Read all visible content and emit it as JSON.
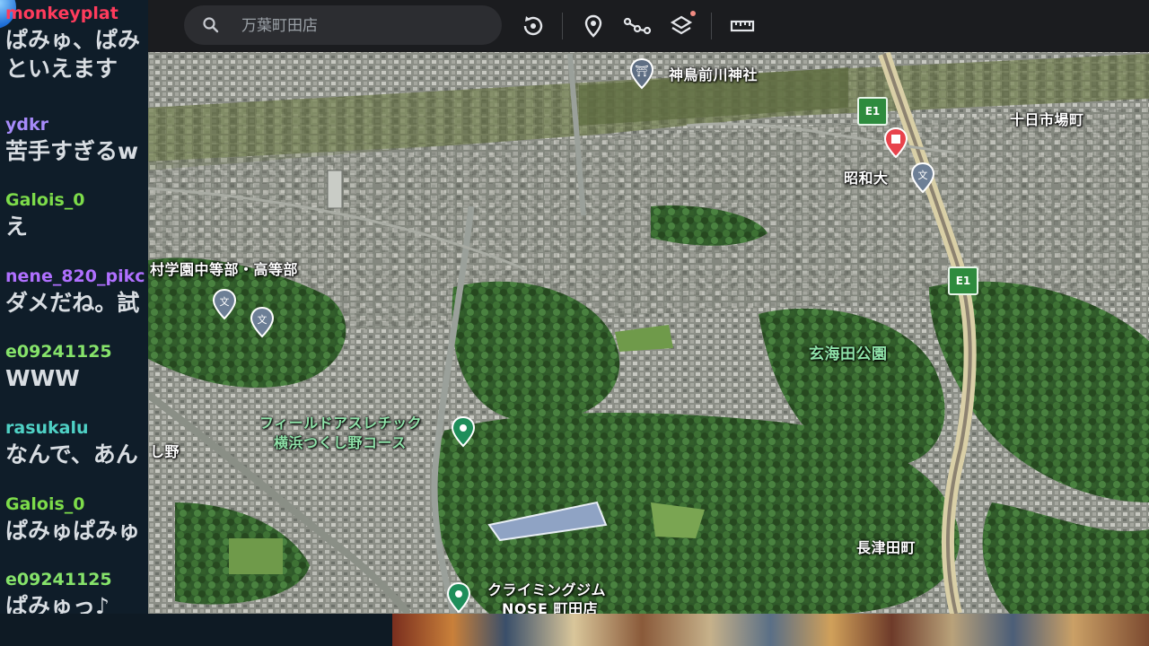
{
  "chat": {
    "messages": [
      {
        "user": "monkeyplat",
        "color": "#ff3b5c",
        "text": "ぱみゅ、ぱみ",
        "text2": "といえます"
      },
      {
        "user": "ydkr",
        "color": "#a78bfa",
        "text": "苦手すぎるw"
      },
      {
        "user": "Galois_0",
        "color": "#7ddc4a",
        "text": "え"
      },
      {
        "user": "nene_820_pikc",
        "color": "#b070ff",
        "text": "ダメだね。試"
      },
      {
        "user": "e09241125",
        "color": "#86e36a",
        "text": "WWW"
      },
      {
        "user": "rasukalu",
        "color": "#4fd1c5",
        "text": "なんで、あん"
      },
      {
        "user": "Galois_0",
        "color": "#7ddc4a",
        "text": "ぱみゅぱみゅ"
      },
      {
        "user": "e09241125",
        "color": "#86e36a",
        "text": "ぱみゅっ♪"
      }
    ]
  },
  "toolbar": {
    "search_placeholder": "万葉町田店",
    "icons": [
      "search-icon",
      "rotate-view-icon",
      "location-pin-icon",
      "route-icon",
      "layers-icon",
      "ruler-icon"
    ],
    "layers_badge_color": "#f28b82"
  },
  "map": {
    "labels": {
      "shrine": "神鳥前川神社",
      "tokaichiba": "十日市場町",
      "showa": "昭和大",
      "school": "村学園中等部・高等部",
      "genkai_park": "玄海田公園",
      "field_athletic_1": "フィールドアスレチック",
      "field_athletic_2": "横浜つくし野コース",
      "tsukushino": "し野",
      "nagatsuda": "長津田町",
      "climbing_1": "クライミングジム",
      "climbing_2": "NOSE 町田店"
    },
    "route_markers": [
      "E1",
      "E1"
    ],
    "colors": {
      "park_label": "#8fe3a9",
      "route_marker": "#2e8b3e",
      "hospital_pin": "#e8434c",
      "poi_pin": "#1e8e5a"
    }
  }
}
